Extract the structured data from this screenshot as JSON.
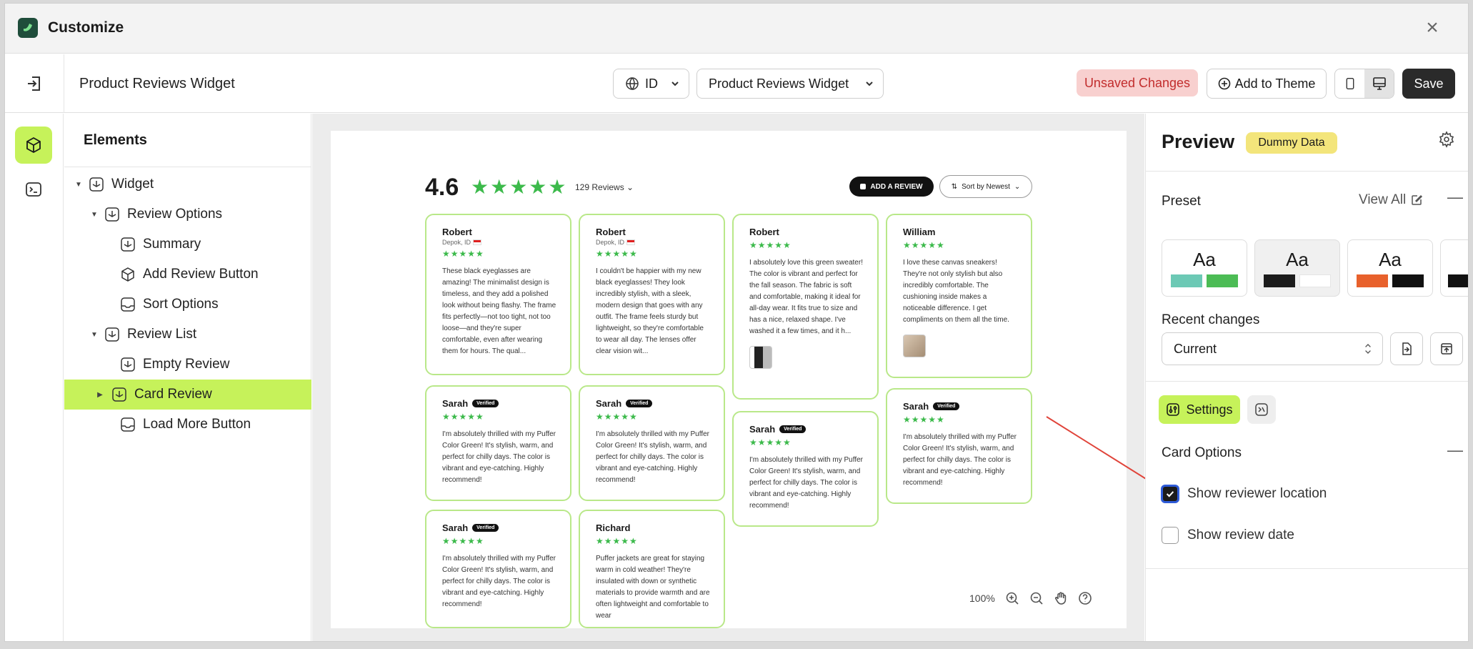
{
  "app": {
    "title": "Customize"
  },
  "toolbar": {
    "page_title": "Product Reviews Widget",
    "language": "ID",
    "widget_select": "Product Reviews Widget",
    "unsaved": "Unsaved Changes",
    "add_to_theme": "Add to Theme",
    "save": "Save"
  },
  "elements": {
    "title": "Elements",
    "tree": [
      {
        "label": "Widget"
      },
      {
        "label": "Review Options"
      },
      {
        "label": "Summary"
      },
      {
        "label": "Add Review Button"
      },
      {
        "label": "Sort Options"
      },
      {
        "label": "Review List"
      },
      {
        "label": "Empty Review"
      },
      {
        "label": "Card Review"
      },
      {
        "label": "Load More Button"
      }
    ]
  },
  "canvas": {
    "rating": "4.6",
    "stars": "★★★★★",
    "review_count": "129 Reviews",
    "add_review": "ADD A REVIEW",
    "sort": "Sort by Newest",
    "zoom": "100%",
    "cards": [
      {
        "name": "Robert",
        "location": "Depok, ID",
        "stars": "★★★★★",
        "verified": "",
        "body": "These black eyeglasses are amazing! The minimalist design is timeless, and they add a polished look without being flashy. The frame fits perfectly—not too tight, not too loose—and they're super comfortable, even after wearing them for hours. The qual..."
      },
      {
        "name": "Robert",
        "location": "Depok, ID",
        "stars": "★★★★★",
        "verified": "",
        "body": "I couldn't be happier with my new black eyeglasses! They look incredibly stylish, with a sleek, modern design that goes with any outfit. The frame feels sturdy but lightweight, so they're comfortable to wear all day. The lenses offer clear vision wit..."
      },
      {
        "name": "Robert",
        "location": "",
        "stars": "★★★★★",
        "verified": "",
        "body": "I absolutely love this green sweater! The color is vibrant and perfect for the fall season. The fabric is soft and comfortable, making it ideal for all-day wear. It fits true to size and has a nice, relaxed shape. I've washed it a few times, and it h..."
      },
      {
        "name": "William",
        "location": "",
        "stars": "★★★★★",
        "verified": "",
        "body": "I love these canvas sneakers! They're not only stylish but also incredibly comfortable. The cushioning inside makes a noticeable difference. I get compliments on them all the time."
      },
      {
        "name": "Sarah",
        "location": "",
        "stars": "★★★★★",
        "verified": "Verified",
        "body": "I'm absolutely thrilled with my Puffer Color Green! It's stylish, warm, and perfect for chilly days. The color is vibrant and eye-catching. Highly recommend!"
      },
      {
        "name": "Sarah",
        "location": "",
        "stars": "★★★★★",
        "verified": "Verified",
        "body": "I'm absolutely thrilled with my Puffer Color Green! It's stylish, warm, and perfect for chilly days. The color is vibrant and eye-catching. Highly recommend!"
      },
      {
        "name": "Sarah",
        "location": "",
        "stars": "★★★★★",
        "verified": "Verified",
        "body": "I'm absolutely thrilled with my Puffer Color Green! It's stylish, warm, and perfect for chilly days. The color is vibrant and eye-catching. Highly recommend!"
      },
      {
        "name": "Sarah",
        "location": "",
        "stars": "★★★★★",
        "verified": "Verified",
        "body": "I'm absolutely thrilled with my Puffer Color Green! It's stylish, warm, and perfect for chilly days. The color is vibrant and eye-catching. Highly recommend!"
      },
      {
        "name": "Sarah",
        "location": "",
        "stars": "★★★★★",
        "verified": "Verified",
        "body": "I'm absolutely thrilled with my Puffer Color Green! It's stylish, warm, and perfect for chilly days. The color is vibrant and eye-catching. Highly recommend!"
      },
      {
        "name": "Richard",
        "location": "",
        "stars": "★★★★★",
        "verified": "",
        "body": "Puffer jackets are great for staying warm in cold weather! They're insulated with down or synthetic materials to provide warmth and are often lightweight and comfortable to wear"
      }
    ]
  },
  "preview": {
    "title": "Preview",
    "badge": "Dummy Data",
    "preset_label": "Preset",
    "view_all": "View All",
    "preset_aa": "Aa",
    "presets": [
      {
        "c1": "#6cc9b5",
        "c2": "#4cbc55"
      },
      {
        "c1": "#1c1c1c",
        "c2": "#ffffff"
      },
      {
        "c1": "#e8612c",
        "c2": "#111111"
      }
    ],
    "recent_label": "Recent changes",
    "recent_value": "Current",
    "settings_tab": "Settings",
    "card_options": "Card Options",
    "show_location": "Show reviewer location",
    "show_date": "Show review date",
    "show_location_checked": true,
    "show_date_checked": false
  },
  "colors": {
    "accent": "#c6f25a",
    "star": "#3cba4b",
    "card_border": "#b9e889",
    "unsaved_bg": "#f8d0cf",
    "badge_bg": "#f3e57b"
  }
}
